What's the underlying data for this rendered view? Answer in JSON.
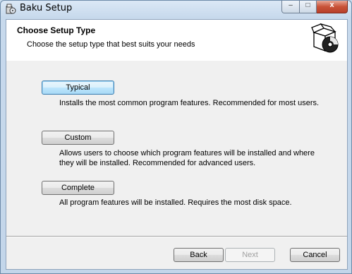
{
  "window": {
    "title": "Baku Setup"
  },
  "caption": {
    "minimize": "–",
    "maximize": "□",
    "close": "x"
  },
  "header": {
    "title": "Choose Setup Type",
    "subtitle": "Choose the setup type that best suits your needs"
  },
  "options": [
    {
      "label": "Typical",
      "description": "Installs the most common program features. Recommended for most users."
    },
    {
      "label": "Custom",
      "description": "Allows users to choose which program features will be installed and where they will be installed. Recommended for advanced users."
    },
    {
      "label": "Complete",
      "description": "All program features will be installed. Requires the most disk space."
    }
  ],
  "footer": {
    "back": "Back",
    "next": "Next",
    "cancel": "Cancel"
  },
  "colors": {
    "focus_border": "#3c7fb1",
    "close_button": "#c85238"
  }
}
